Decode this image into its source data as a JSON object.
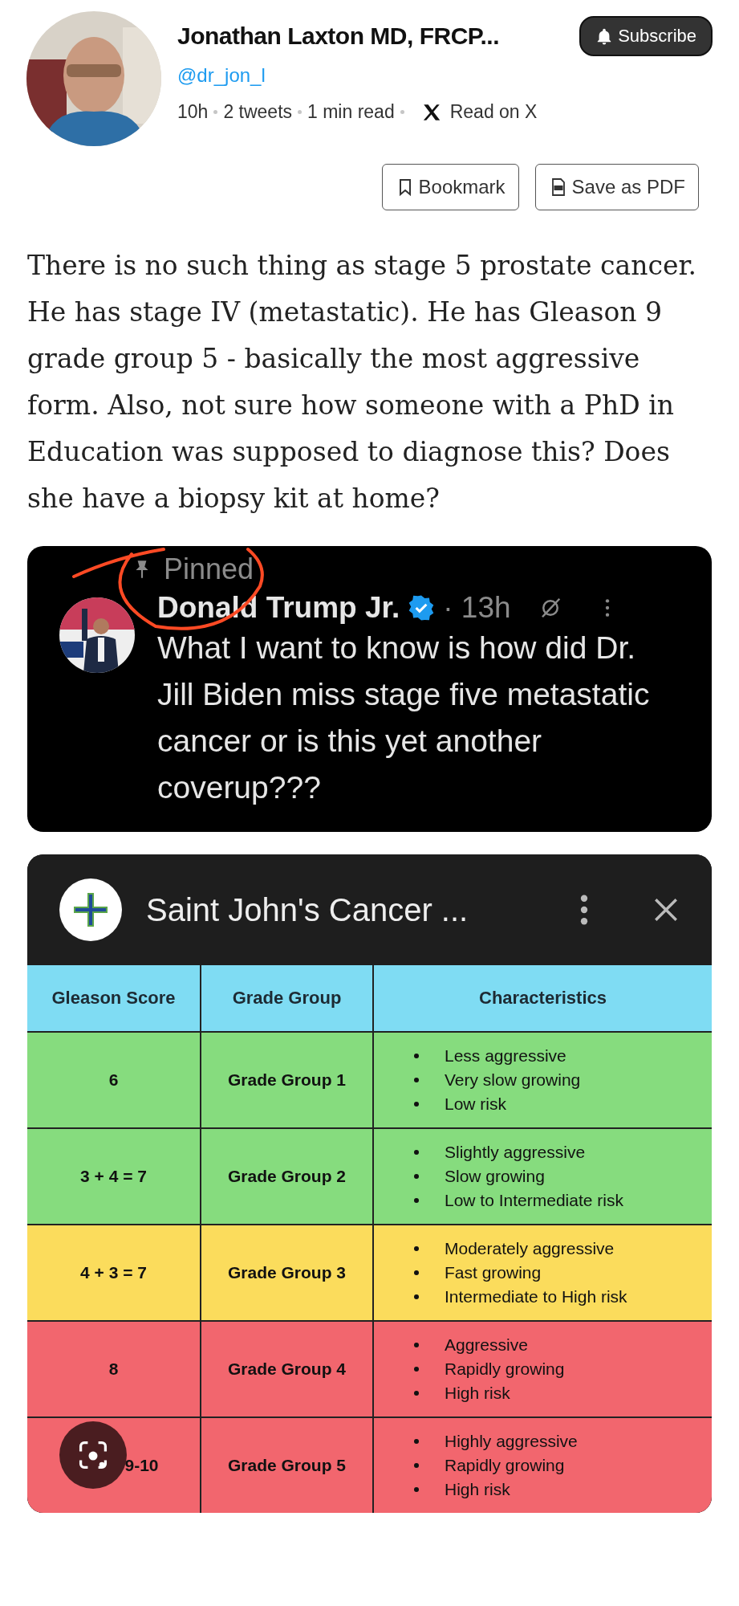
{
  "author": {
    "name": "Jonathan Laxton MD, FRCP...",
    "handle": "@dr_jon_l",
    "meta": [
      "10h",
      "2 tweets",
      "1 min read"
    ],
    "read_on": "Read on X",
    "subscribe": "Subscribe"
  },
  "actions": [
    {
      "kind": "bookmark",
      "label": "Bookmark"
    },
    {
      "kind": "pdf",
      "label": "Save as PDF"
    }
  ],
  "tweet_text": "There is no such thing as stage 5 prostate cancer. He has stage IV (metastatic). He has Gleason 9 grade group 5 - basically the most aggressive form. Also, not sure how someone with a PhD in Education was supposed to diagnose this? Does she have a biopsy kit at home?",
  "embedded_post": {
    "pinned": "Pinned",
    "name": "Donald Trump Jr.",
    "verified": true,
    "time": "· 13h",
    "text": "What I want to know is how did Dr. Jill Biden miss stage five metastatic cancer or is this yet another coverup???"
  },
  "embedded_table": {
    "title": "Saint John's Cancer ...",
    "columns": [
      "Gleason Score",
      "Grade Group",
      "Characteristics"
    ],
    "rows": [
      {
        "score": "6",
        "group": "Grade Group 1",
        "color": "#86dc7e",
        "traits": [
          "Less aggressive",
          "Very slow growing",
          "Low risk"
        ]
      },
      {
        "score": "3 + 4 = 7",
        "group": "Grade Group 2",
        "color": "#86dc7e",
        "traits": [
          "Slightly aggressive",
          "Slow growing",
          "Low to Intermediate risk"
        ]
      },
      {
        "score": "4 + 3 = 7",
        "group": "Grade Group 3",
        "color": "#fbdc5c",
        "traits": [
          "Moderately aggressive",
          "Fast growing",
          "Intermediate to High risk"
        ]
      },
      {
        "score": "8",
        "group": "Grade Group 4",
        "color": "#f2666e",
        "traits": [
          "Aggressive",
          "Rapidly growing",
          "High risk"
        ]
      },
      {
        "score": "9-10",
        "group": "Grade Group 5",
        "color": "#f2666e",
        "traits": [
          "Highly aggressive",
          "Rapidly growing",
          "High risk"
        ]
      }
    ]
  }
}
